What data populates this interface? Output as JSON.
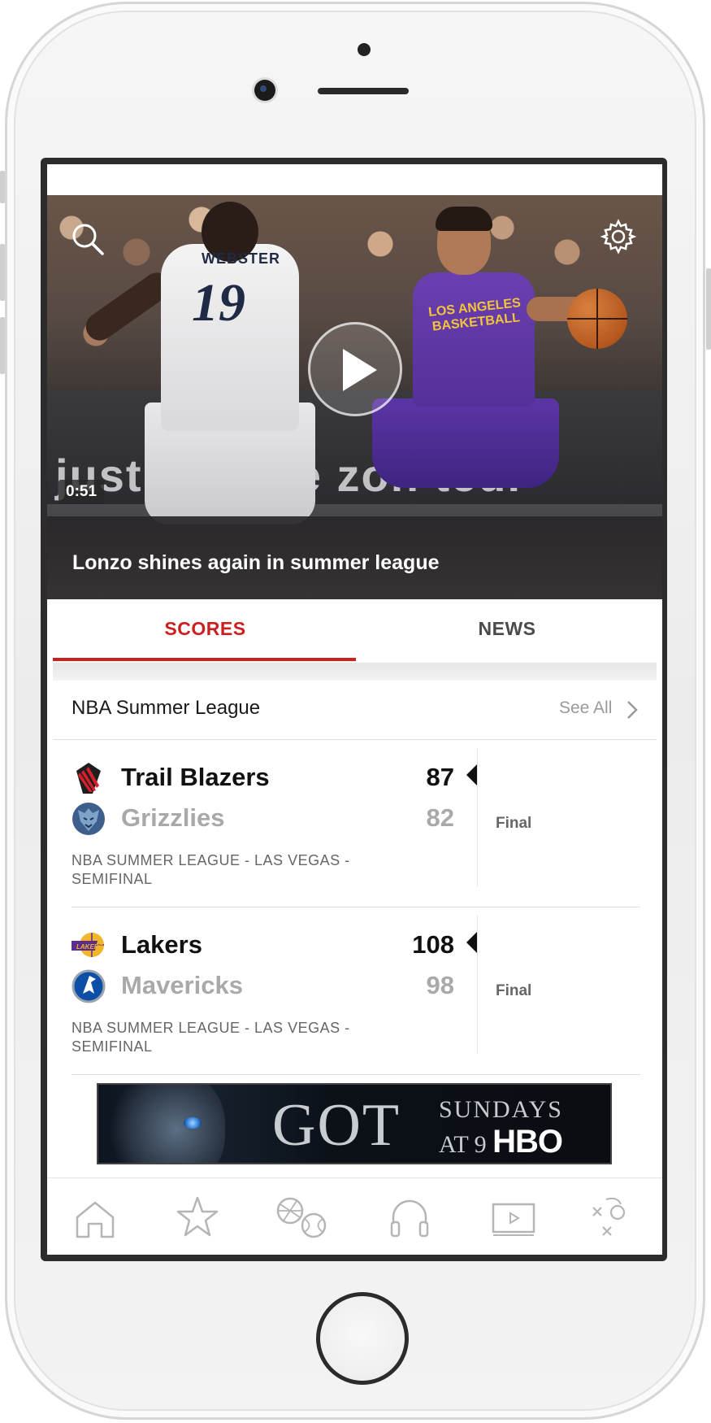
{
  "hero": {
    "title": "Lonzo shines again in summer league",
    "duration": "0:51",
    "board_text": "just w     d. Ve  zon     ted.",
    "player1_name": "WEBSTER",
    "player1_number": "19",
    "player2_text": "LOS ANGELES\nBASKETBALL"
  },
  "tabs": [
    {
      "label": "SCORES",
      "active": true
    },
    {
      "label": "NEWS",
      "active": false
    }
  ],
  "league": {
    "title": "NBA Summer League",
    "see_all": "See All"
  },
  "games": [
    {
      "team1": {
        "name": "Trail Blazers",
        "score": "87",
        "winner": true,
        "logo": "trail-blazers-logo"
      },
      "team2": {
        "name": "Grizzlies",
        "score": "82",
        "winner": false,
        "logo": "grizzlies-logo"
      },
      "status": "Final",
      "subtitle": "NBA SUMMER LEAGUE - LAS VEGAS - SEMIFINAL"
    },
    {
      "team1": {
        "name": "Lakers",
        "score": "108",
        "winner": true,
        "logo": "lakers-logo"
      },
      "team2": {
        "name": "Mavericks",
        "score": "98",
        "winner": false,
        "logo": "mavericks-logo"
      },
      "status": "Final",
      "subtitle": "NBA SUMMER LEAGUE - LAS VEGAS - SEMIFINAL"
    }
  ],
  "ad": {
    "title": "GOT",
    "line1": "SUNDAYS",
    "line2": "AT 9",
    "network": "HBO"
  },
  "bottom_nav": [
    {
      "icon": "home-icon"
    },
    {
      "icon": "star-icon"
    },
    {
      "icon": "sports-balls-icon"
    },
    {
      "icon": "headphones-icon"
    },
    {
      "icon": "video-icon"
    },
    {
      "icon": "xo-play-icon"
    }
  ],
  "colors": {
    "accent": "#cc1f1f",
    "winner_text": "#111111",
    "loser_text": "#a9a9a9"
  }
}
